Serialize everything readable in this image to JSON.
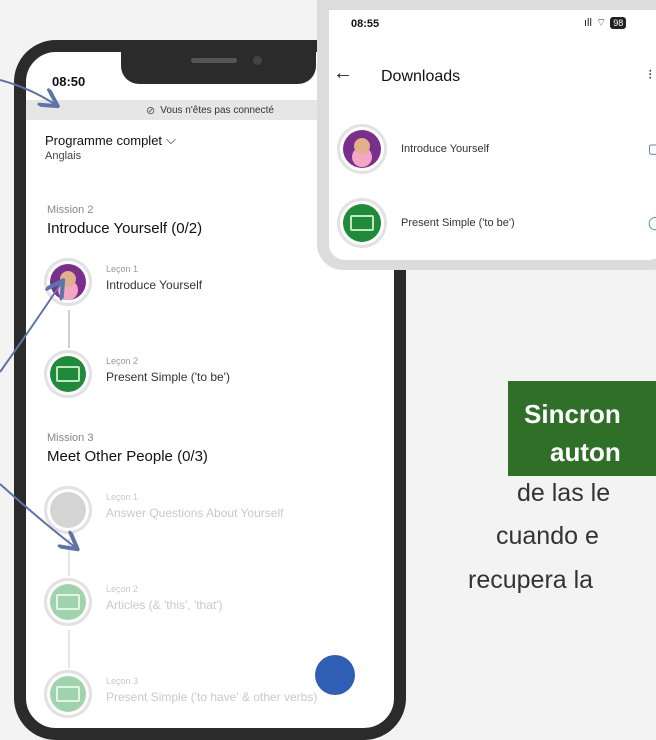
{
  "phone1": {
    "time": "08:50",
    "offline_notice": "Vous n'êtes pas connecté",
    "program_title": "Programme complet",
    "program_subtitle": "Anglais",
    "missions": [
      {
        "label": "Mission 2",
        "title": "Introduce Yourself (0/2)",
        "lessons": [
          {
            "num": "Leçon 1",
            "name": "Introduce Yourself"
          },
          {
            "num": "Leçon 2",
            "name": "Present Simple ('to be')"
          }
        ]
      },
      {
        "label": "Mission 3",
        "title": "Meet Other People (0/3)",
        "lessons": [
          {
            "num": "Leçon 1",
            "name": "Answer Questions About Yourself"
          },
          {
            "num": "Leçon 2",
            "name": "Articles (& 'this', 'that')"
          },
          {
            "num": "Leçon 3",
            "name": "Present Simple ('to have' & other verbs)"
          }
        ]
      }
    ]
  },
  "phone2": {
    "time": "08:55",
    "battery": "98",
    "title": "Downloads",
    "items": [
      {
        "name": "Introduce Yourself"
      },
      {
        "name": "Present Simple ('to be')"
      }
    ]
  },
  "promo": {
    "highlight_line1": "Sincron",
    "highlight_line2": "auton",
    "line3": "de las le",
    "line4": "cuando e",
    "line5": "recupera la"
  },
  "colors": {
    "highlight_bg": "#2f6f27",
    "lesson_purple": "#7b2f8c",
    "lesson_green": "#1e8a3a",
    "arrow": "#5c74a8"
  }
}
